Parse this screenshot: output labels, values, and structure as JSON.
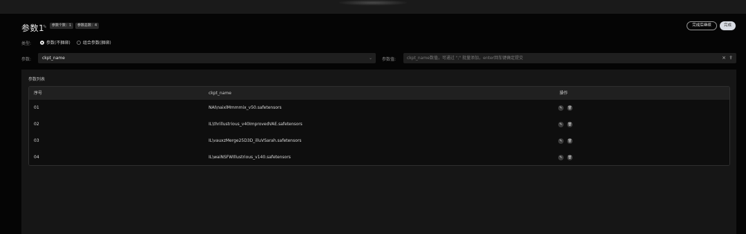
{
  "header": {
    "title": "参数1",
    "edit_icon": "pencil-icon",
    "badges": [
      "参数个数：1",
      "参数总数：4"
    ],
    "save_continue_label": "完成后继续",
    "done_label": "完成"
  },
  "type_field": {
    "label": "类型:",
    "options": [
      "参数(不捆绑)",
      "组合参数(捆绑)"
    ],
    "selected": 0
  },
  "param_field": {
    "label": "参数:",
    "value": "ckpt_name",
    "caret_icon": "chevron-down-icon"
  },
  "value_field": {
    "label": "参数值:",
    "placeholder": "ckpt_name数值，可通过 \";\" 批量添加，enter回车键确定提交",
    "clear_icon": "close-icon",
    "upload_icon": "upload-icon"
  },
  "list": {
    "title": "参数列表",
    "columns": [
      "序号",
      "ckpt_name",
      "操作"
    ],
    "rows": [
      {
        "index": "01",
        "name": "NAI\\naixlMmmmix_v50.safetensors"
      },
      {
        "index": "02",
        "name": "IL\\thrillustrious_v40ImprovedVAE.safetensors"
      },
      {
        "index": "03",
        "name": "IL\\vauxzMerge25D3D_illuVSarah.safetensors"
      },
      {
        "index": "04",
        "name": "IL\\waiNSFWIllustrious_v140.safetensors"
      }
    ],
    "row_actions": [
      "edit-icon",
      "delete-icon"
    ]
  }
}
